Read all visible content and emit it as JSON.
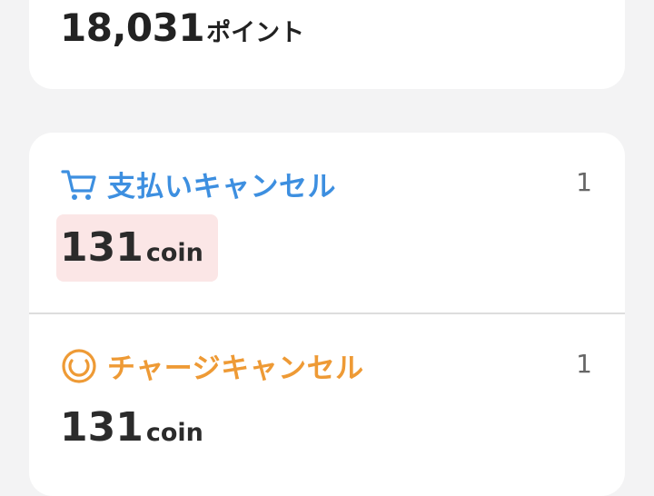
{
  "points": {
    "value": "18,031",
    "unit": "ポイント"
  },
  "history": [
    {
      "icon": "cart-icon",
      "title": "支払いキャンセル",
      "count": "1",
      "amount": "131",
      "unit": "coin",
      "color": "#3d8fe0"
    },
    {
      "icon": "charge-icon",
      "title": "チャージキャンセル",
      "count": "1",
      "amount": "131",
      "unit": "coin",
      "color": "#ee9a35"
    }
  ],
  "colors": {
    "background": "#f3f3f4",
    "card": "#ffffff",
    "highlight": "#fbe6e6"
  }
}
